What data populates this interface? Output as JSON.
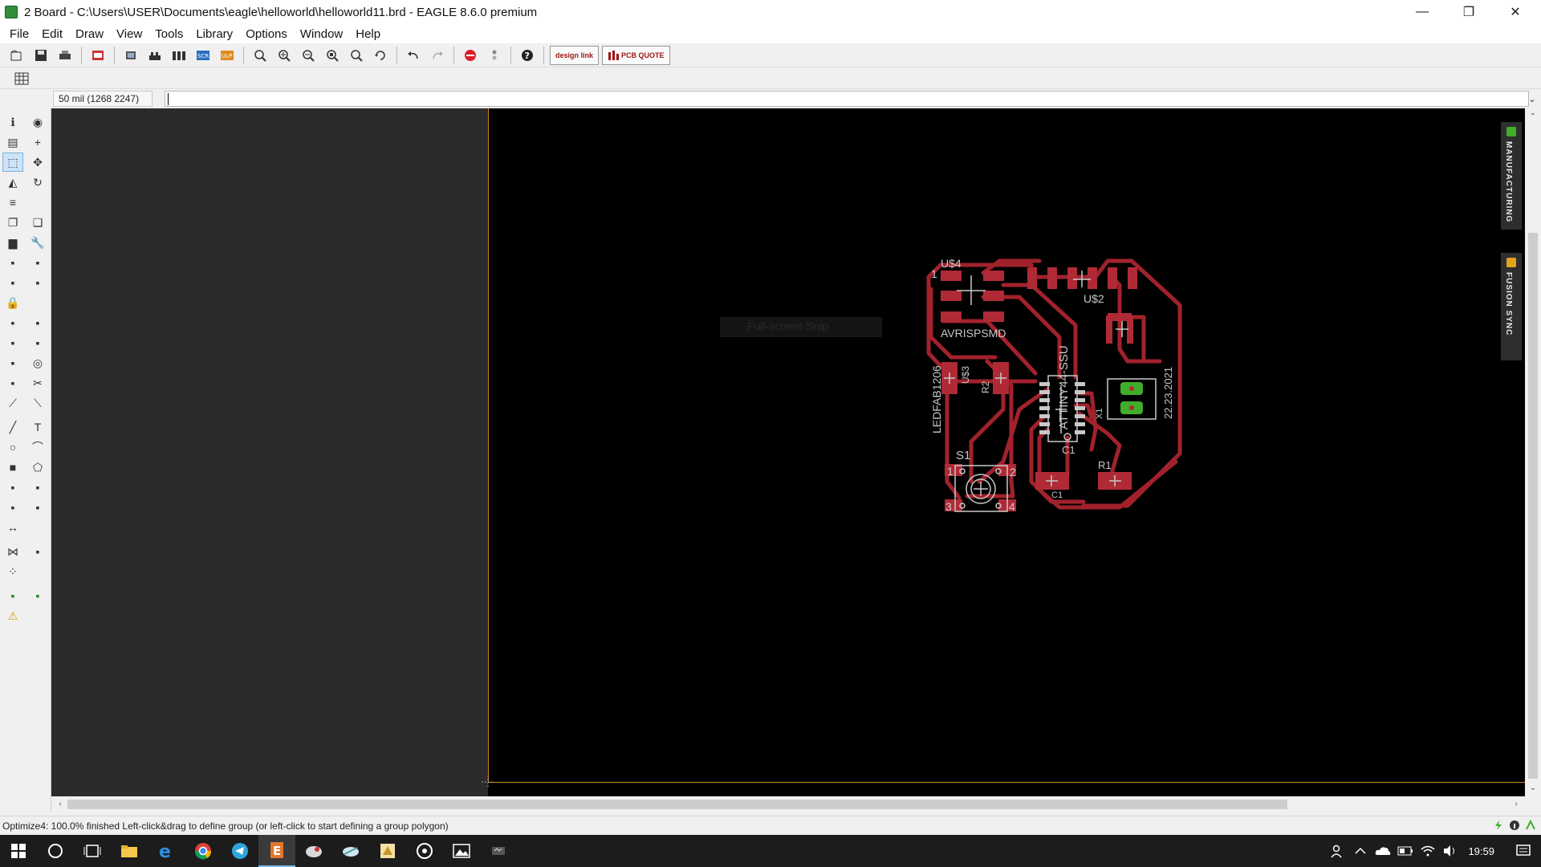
{
  "window": {
    "title": "2 Board - C:\\Users\\USER\\Documents\\eagle\\helloworld\\helloworld11.brd - EAGLE 8.6.0 premium",
    "minimize": "—",
    "maximize": "❐",
    "close": "✕"
  },
  "menu": {
    "items": [
      {
        "label": "File"
      },
      {
        "label": "Edit"
      },
      {
        "label": "Draw"
      },
      {
        "label": "View"
      },
      {
        "label": "Tools"
      },
      {
        "label": "Library"
      },
      {
        "label": "Options"
      },
      {
        "label": "Window"
      },
      {
        "label": "Help"
      }
    ]
  },
  "toolbar": {
    "design_link": "design link",
    "pcb_quote": "PCB QUOTE"
  },
  "command": {
    "coordinate": "50 mil (1268 2247)",
    "value": ""
  },
  "canvas": {
    "ghost_tooltip": "Full-screen Snip",
    "labels": {
      "u4": "U$4",
      "pin1_header": "1",
      "u2": "U$2",
      "avrispsmd": "AVRISPSMD",
      "ledfab": "LEDFAB1206",
      "u3": "U$3",
      "r2": "R2",
      "attiny": "ATTINY44-SSU",
      "x1": "X1",
      "date": "22.23.2021",
      "s1": "S1",
      "c1a": "C1",
      "r1": "R1",
      "c1b": "C1",
      "sw1": "1",
      "sw2": "2",
      "sw3": "3",
      "sw4": "4"
    },
    "colors": {
      "trace": "#a1222c",
      "pad": "#b02a36",
      "silk": "#c8c8c8",
      "green_pad": "#3fae2a",
      "frame": "#c8891c"
    }
  },
  "sidetabs": {
    "manufacturing": "MANUFACTURING",
    "fusion_sync": "FUSION SYNC"
  },
  "status": {
    "message": "Optimize4: 100.0% finished Left-click&drag to define group (or left-click to start defining a group polygon)"
  },
  "taskbar": {
    "time": "19:59"
  }
}
